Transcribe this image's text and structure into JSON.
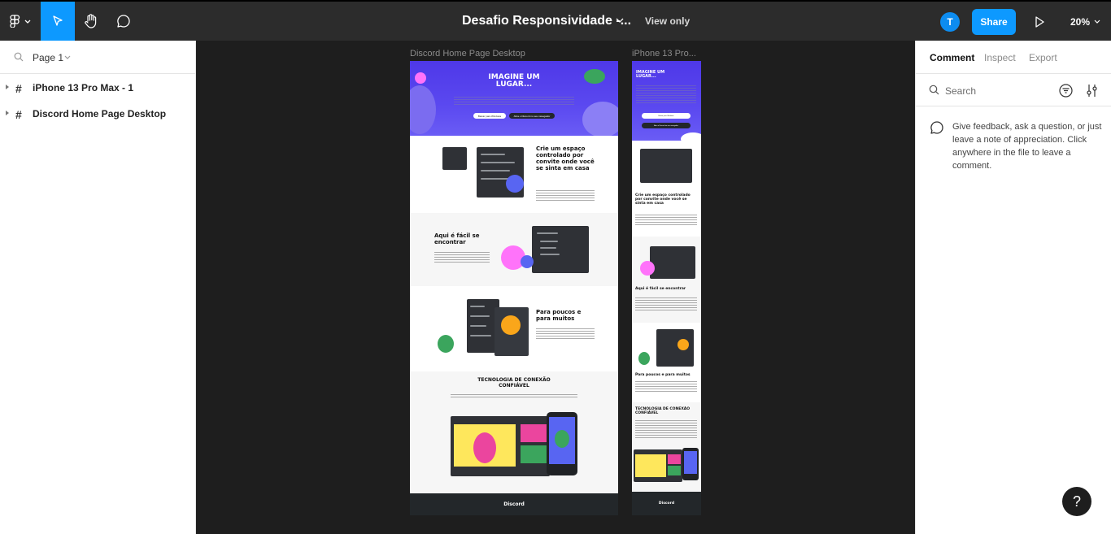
{
  "toolbar": {
    "title": "Desafio Responsividade -...",
    "view_only": "View only",
    "avatar_initial": "T",
    "share_label": "Share",
    "zoom": "20%"
  },
  "left_panel": {
    "page_label": "Page 1",
    "layers": [
      {
        "name": "iPhone 13 Pro Max - 1"
      },
      {
        "name": "Discord Home Page Desktop"
      }
    ]
  },
  "canvas": {
    "desktop_frame_label": "Discord Home Page Desktop",
    "mobile_frame_label": "iPhone 13 Pro...",
    "desktop": {
      "hero_title": "IMAGINE UM LUGAR...",
      "hero_btn_windows": "Baixar para Windows",
      "hero_btn_browser": "Abra o Discord no seu navegador",
      "section1_heading": "Crie um espaço controlado por convite onde você se sinta em casa",
      "section2_heading": "Aqui é fácil se encontrar",
      "section3_heading": "Para poucos e para muitos",
      "section4_heading": "TECNOLOGIA DE CONEXÃO CONFIÁVEL",
      "footer_brand": "Discord"
    },
    "mobile": {
      "hero_title": "IMAGINE UM LUGAR...",
      "hero_btn_windows": "Baixar para Windows",
      "hero_btn_browser": "Abra o Discord no seu navegador",
      "section1_heading": "Crie um espaço controlado por convite onde você se sinta em casa",
      "section2_heading": "Aqui é fácil se encontrar",
      "section3_heading": "Para poucos e para muitos",
      "section4_heading": "TECNOLOGIA DE CONEXÃO CONFIÁVEL",
      "footer_brand": "Discord"
    }
  },
  "right_panel": {
    "tabs": [
      "Comment",
      "Inspect",
      "Export"
    ],
    "active_tab": "Comment",
    "search_placeholder": "Search",
    "hint": "Give feedback, ask a question, or just leave a note of appreciation. Click anywhere in the file to leave a comment."
  },
  "help_label": "?",
  "colors": {
    "accent": "#0d99ff",
    "toolbar_bg": "#2c2c2c",
    "canvas_bg": "#1e1e1e",
    "discord_blurple": "#5865f2"
  },
  "icons": [
    "figma-main-menu-icon",
    "move-tool-icon",
    "hand-tool-icon",
    "comment-tool-icon",
    "chevron-down-icon",
    "play-icon",
    "search-icon",
    "filter-icon",
    "settings-sliders-icon",
    "comment-bubble-icon",
    "frame-hash-icon",
    "help-icon"
  ]
}
